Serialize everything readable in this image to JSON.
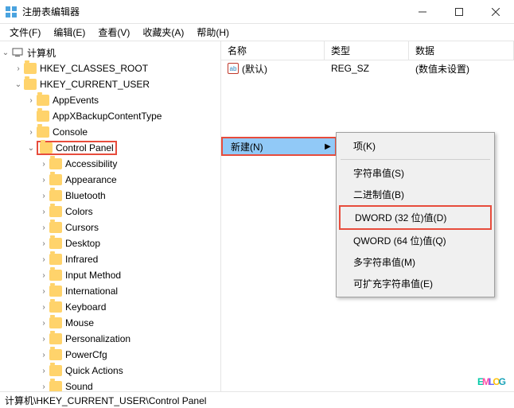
{
  "titlebar": {
    "title": "注册表编辑器"
  },
  "menubar": {
    "items": [
      "文件(F)",
      "编辑(E)",
      "查看(V)",
      "收藏夹(A)",
      "帮助(H)"
    ]
  },
  "tree": {
    "root": "计算机",
    "hives": [
      "HKEY_CLASSES_ROOT",
      "HKEY_CURRENT_USER"
    ],
    "hkcu_children": [
      "AppEvents",
      "AppXBackupContentType",
      "Console",
      "Control Panel"
    ],
    "control_panel_children": [
      "Accessibility",
      "Appearance",
      "Bluetooth",
      "Colors",
      "Cursors",
      "Desktop",
      "Infrared",
      "Input Method",
      "International",
      "Keyboard",
      "Mouse",
      "Personalization",
      "PowerCfg",
      "Quick Actions",
      "Sound"
    ]
  },
  "list": {
    "headers": {
      "name": "名称",
      "type": "类型",
      "data": "数据"
    },
    "rows": [
      {
        "icon": "ab",
        "name": "(默认)",
        "type": "REG_SZ",
        "data": "(数值未设置)"
      }
    ]
  },
  "context_menu": {
    "new_label": "新建(N)",
    "submenu": [
      "项(K)",
      "-",
      "字符串值(S)",
      "二进制值(B)",
      "DWORD (32 位)值(D)",
      "QWORD (64 位)值(Q)",
      "多字符串值(M)",
      "可扩充字符串值(E)"
    ],
    "highlight_index": 4
  },
  "statusbar": {
    "path": "计算机\\HKEY_CURRENT_USER\\Control Panel"
  },
  "watermark": "EMLOG"
}
